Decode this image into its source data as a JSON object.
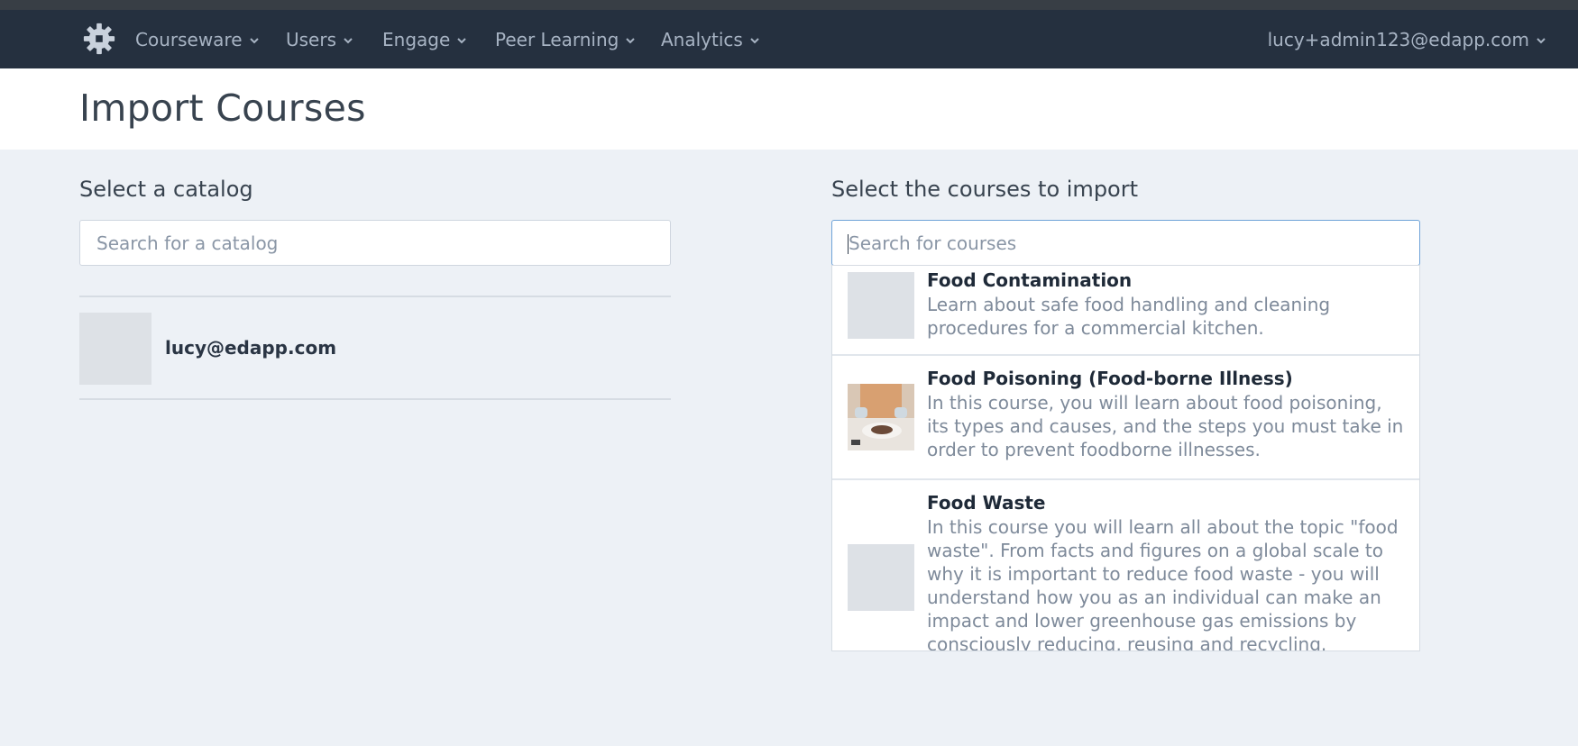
{
  "nav": {
    "items": [
      {
        "label": "Courseware"
      },
      {
        "label": "Users"
      },
      {
        "label": "Engage"
      },
      {
        "label": "Peer Learning"
      },
      {
        "label": "Analytics"
      }
    ],
    "user_email": "lucy+admin123@edapp.com"
  },
  "header": {
    "title": "Import Courses"
  },
  "catalog": {
    "label": "Select a catalog",
    "search_placeholder": "Search for a catalog",
    "items": [
      {
        "name": "lucy@edapp.com"
      }
    ]
  },
  "courses": {
    "label": "Select the courses to import",
    "search_placeholder": "Search for courses",
    "results": [
      {
        "title": "Food Contamination",
        "description": "Learn about safe food handling and cleaning procedures for a commercial kitchen."
      },
      {
        "title": "Food Poisoning (Food-borne Illness)",
        "description": "In this course, you will learn about food poisoning, its types and causes, and the steps you must take in order to prevent foodborne illnesses."
      },
      {
        "title": "Food Waste",
        "description": "In this course you will learn all about the topic \"food waste\". From facts and figures on a global scale to why it is important to reduce food waste - you will understand how you as an individual can make an impact and lower greenhouse gas emissions by consciously reducing, reusing and recycling."
      }
    ]
  },
  "colors": {
    "navbar": "#25303f",
    "background": "#edf1f6",
    "focus_border": "#6fa3d8"
  },
  "icons": {
    "logo": "gear-icon",
    "dropdown": "chevron-down-icon"
  }
}
